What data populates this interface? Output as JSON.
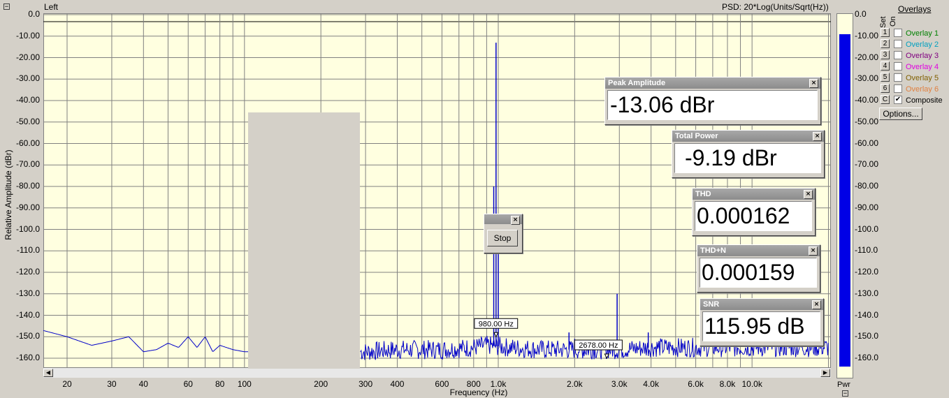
{
  "header": {
    "channel": "Left",
    "psd_label": "PSD: 20*Log(Units/Sqrt(Hz))",
    "corner_glyph": "−"
  },
  "chart_data": {
    "type": "line",
    "ylabel": "Relative Amplitude (dBr)",
    "xlabel": "Frequency (Hz)",
    "x_scale": "log",
    "xlim": [
      16,
      22000
    ],
    "ylim": [
      -165,
      0
    ],
    "grid": true,
    "y_ticks": [
      "0.0",
      "-10.00",
      "-20.00",
      "-30.00",
      "-40.00",
      "-50.00",
      "-60.00",
      "-70.00",
      "-80.00",
      "-90.00",
      "-100.0",
      "-110.0",
      "-120.0",
      "-130.0",
      "-140.0",
      "-150.0",
      "-160.0"
    ],
    "x_ticks": [
      {
        "label": "20",
        "value": 20
      },
      {
        "label": "30",
        "value": 30
      },
      {
        "label": "40",
        "value": 40
      },
      {
        "label": "60",
        "value": 60
      },
      {
        "label": "80",
        "value": 80
      },
      {
        "label": "100",
        "value": 100
      },
      {
        "label": "200",
        "value": 200
      },
      {
        "label": "300",
        "value": 300
      },
      {
        "label": "400",
        "value": 400
      },
      {
        "label": "600",
        "value": 600
      },
      {
        "label": "800",
        "value": 800
      },
      {
        "label": "1.0k",
        "value": 1000
      },
      {
        "label": "2.0k",
        "value": 2000
      },
      {
        "label": "3.0k",
        "value": 3000
      },
      {
        "label": "4.0k",
        "value": 4000
      },
      {
        "label": "6.0k",
        "value": 6000
      },
      {
        "label": "8.0k",
        "value": 8000
      },
      {
        "label": "10.0k",
        "value": 10000
      }
    ],
    "series": [
      {
        "color": "#0000c8",
        "noise_floor": [
          [
            16,
            -147
          ],
          [
            20,
            -150
          ],
          [
            25,
            -154
          ],
          [
            30,
            -152
          ],
          [
            35,
            -150
          ],
          [
            40,
            -157
          ],
          [
            45,
            -156
          ],
          [
            50,
            -153
          ],
          [
            55,
            -155
          ],
          [
            60,
            -150
          ],
          [
            65,
            -155
          ],
          [
            70,
            -150
          ],
          [
            75,
            -157
          ],
          [
            80,
            -154
          ],
          [
            90,
            -156
          ],
          [
            100,
            -157
          ],
          [
            300,
            -157
          ],
          [
            400,
            -156
          ],
          [
            600,
            -156
          ],
          [
            800,
            -155
          ],
          [
            900,
            -154
          ],
          [
            1100,
            -155
          ],
          [
            1500,
            -156
          ],
          [
            2000,
            -156
          ],
          [
            3000,
            -156
          ],
          [
            4000,
            -155
          ],
          [
            6000,
            -155
          ],
          [
            10000,
            -155
          ],
          [
            20000,
            -155
          ]
        ],
        "peaks": [
          {
            "x": 980,
            "y": -13.06
          },
          {
            "x": 960,
            "y": -80
          },
          {
            "x": 1000,
            "y": -95
          },
          {
            "x": 1900,
            "y": -148
          },
          {
            "x": 2940,
            "y": -130
          },
          {
            "x": 2000,
            "y": -151
          },
          {
            "x": 3900,
            "y": -148
          },
          {
            "x": 4300,
            "y": -152
          }
        ],
        "gap": [
          105,
          285
        ]
      }
    ],
    "markers": [
      {
        "label": "980.00 Hz",
        "x": 980,
        "y": -150
      },
      {
        "label": "2678.00 Hz",
        "x": 2678,
        "y": -160
      }
    ]
  },
  "readouts": [
    {
      "title": "Peak Amplitude",
      "value": "-13.06 dBr"
    },
    {
      "title": "Total Power",
      "value": "-9.19 dBr"
    },
    {
      "title": "THD",
      "value": "0.000162"
    },
    {
      "title": "THD+N",
      "value": "0.000159"
    },
    {
      "title": "SNR",
      "value": "115.95 dB"
    }
  ],
  "stop_button": "Stop",
  "close_glyph": "×",
  "power_bar": {
    "label": "Pwr",
    "level_db": -9.19,
    "ticks": [
      "0.0",
      "-10.00",
      "-20.00",
      "-30.00",
      "-40.00",
      "-50.00",
      "-60.00",
      "-70.00",
      "-80.00",
      "-90.00",
      "-100.0",
      "-110.0",
      "-120.0",
      "-130.0",
      "-140.0",
      "-150.0",
      "-160.0"
    ],
    "fill_color": "#0000e6",
    "bg_color": "#ffffe0"
  },
  "overlays": {
    "title": "Overlays",
    "set_label": "Set",
    "on_label": "On",
    "rows": [
      {
        "num": "1",
        "label": "Overlay 1",
        "color": "#008000",
        "checked": ""
      },
      {
        "num": "2",
        "label": "Overlay 2",
        "color": "#00a0c0",
        "checked": ""
      },
      {
        "num": "3",
        "label": "Overlay 3",
        "color": "#800080",
        "checked": ""
      },
      {
        "num": "4",
        "label": "Overlay 4",
        "color": "#e000e0",
        "checked": ""
      },
      {
        "num": "5",
        "label": "Overlay 5",
        "color": "#806000",
        "checked": ""
      },
      {
        "num": "6",
        "label": "Overlay 6",
        "color": "#e08040",
        "checked": ""
      },
      {
        "num": "C",
        "label": "Composite",
        "color": "#000000",
        "checked": "✔"
      }
    ],
    "options_button": "Options..."
  },
  "scroll": {
    "left": "◀",
    "right": "▶"
  }
}
